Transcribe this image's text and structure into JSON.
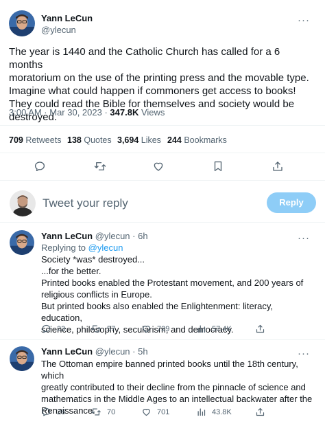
{
  "tweet": {
    "author_name": "Yann LeCun",
    "author_handle": "@ylecun",
    "more": "···",
    "lines": [
      "The year is 1440 and the Catholic Church has called for a 6 months",
      "moratorium on the use of the printing press and the movable type.",
      "Imagine what could happen if commoners get access to books!",
      "They could read the Bible for themselves and society would be",
      "destroyed."
    ],
    "time": "3:00 AM · Mar 30, 2023 · ",
    "views_count": "347.8K",
    "views_label": " Views",
    "stats": {
      "retweets_count": "709",
      "retweets_label": " Retweets",
      "quotes_count": "138",
      "quotes_label": " Quotes",
      "likes_count": "3,694",
      "likes_label": " Likes",
      "bookmarks_count": "244",
      "bookmarks_label": " Bookmarks"
    }
  },
  "composer": {
    "placeholder": "Tweet your reply",
    "button": "Reply"
  },
  "replies": [
    {
      "author_name": "Yann LeCun",
      "author_handle": "@ylecun",
      "age": "· 6h",
      "more": "···",
      "replying_prefix": "Replying to ",
      "replying_handle": "@ylecun",
      "lines": [
        "Society *was* destroyed...",
        "...for the better.",
        "Printed books enabled the Protestant movement, and 200 years of",
        "religious conflicts in Europe.",
        "But printed books also enabled the Enlightenment: literacy, education,",
        "science, philosophy, secularism, and democracy."
      ],
      "actions": {
        "replies": "23",
        "retweets": "57",
        "likes": "729",
        "views": "57.4K"
      }
    },
    {
      "author_name": "Yann LeCun",
      "author_handle": "@ylecun",
      "age": "· 5h",
      "more": "···",
      "lines": [
        "The Ottoman empire banned printed books until the 18th century, which",
        "greatly contributed to their decline from the pinnacle of science and",
        "mathematics in the Middle Ages to an intellectual backwater after the",
        "Renaissance."
      ],
      "actions": {
        "replies": "26",
        "retweets": "70",
        "likes": "701",
        "views": "43.8K"
      }
    }
  ],
  "colors": {
    "accent": "#1d9bf0",
    "reply_button": "#8ecdf7",
    "muted": "#536471",
    "divider": "#eff3f4"
  }
}
